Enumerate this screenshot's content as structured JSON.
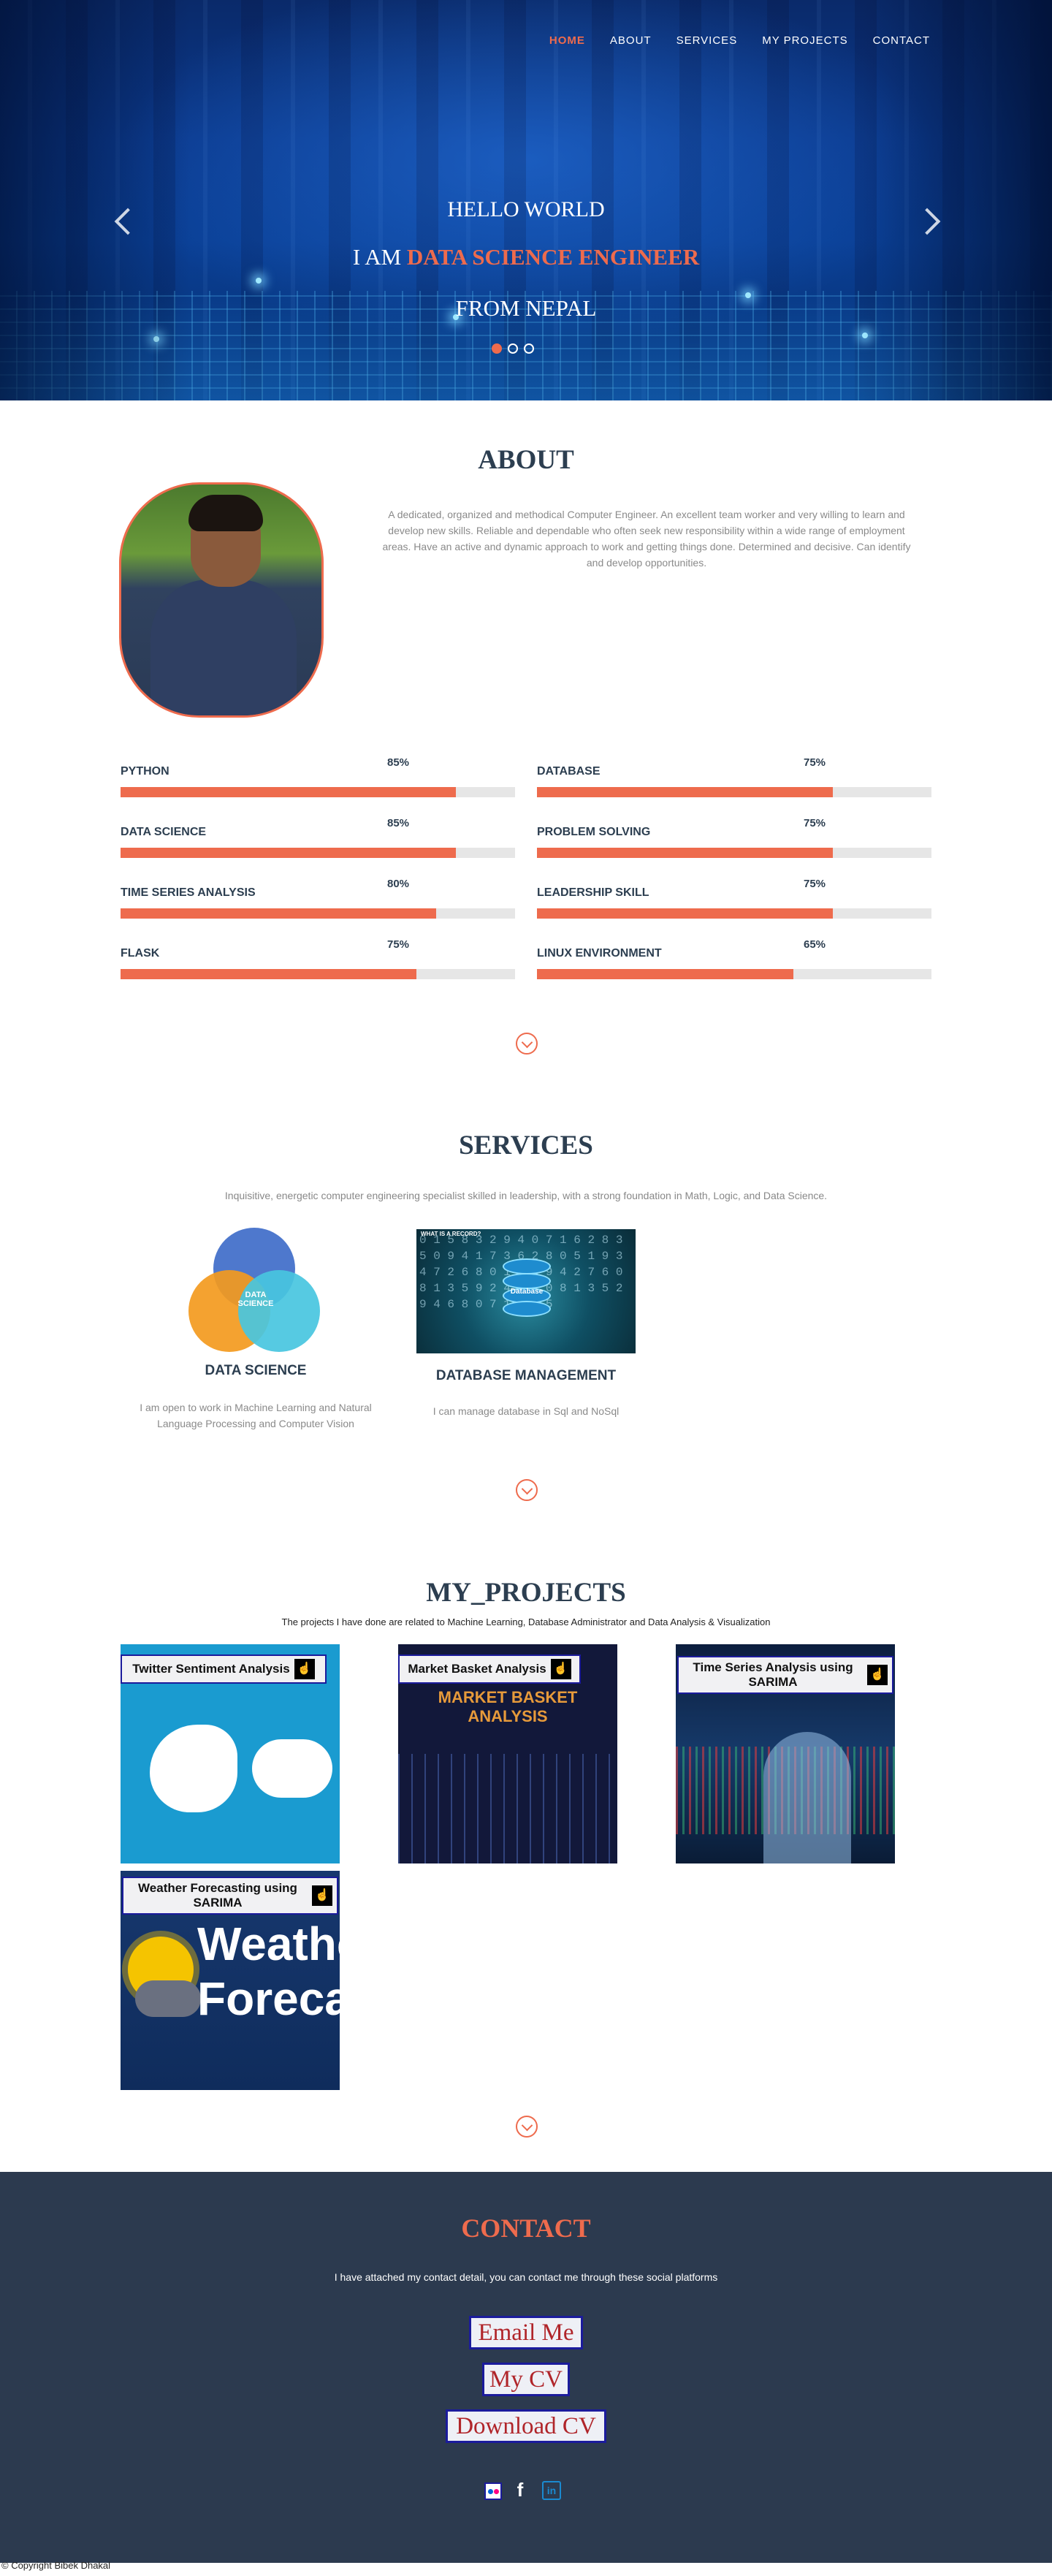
{
  "nav": {
    "items": [
      "HOME",
      "ABOUT",
      "SERVICES",
      "MY PROJECTS",
      "CONTACT"
    ]
  },
  "hero": {
    "line1": "HELLO WORLD",
    "line2_prefix": "I AM ",
    "line2_accent": "DATA SCIENCE ENGINEER",
    "line3": "FROM NEPAL",
    "active_slide": 1,
    "slide_count": 3
  },
  "about": {
    "title": "ABOUT",
    "text": "A dedicated, organized and methodical Computer Engineer. An excellent team worker and very willing to learn and develop new skills. Reliable and dependable who often seek new responsibility within a wide range of employment areas. Have an active and dynamic approach to work and getting things done. Determined and decisive. Can identify and develop opportunities.",
    "skills": [
      {
        "name": "PYTHON",
        "percent": "85%",
        "value": 85
      },
      {
        "name": "DATABASE",
        "percent": "75%",
        "value": 75
      },
      {
        "name": "DATA SCIENCE",
        "percent": "85%",
        "value": 85
      },
      {
        "name": "PROBLEM SOLVING",
        "percent": "75%",
        "value": 75
      },
      {
        "name": "TIME SERIES ANALYSIS",
        "percent": "80%",
        "value": 80
      },
      {
        "name": "LEADERSHIP SKILL",
        "percent": "75%",
        "value": 75
      },
      {
        "name": "FLASK",
        "percent": "75%",
        "value": 75
      },
      {
        "name": "LINUX ENVIRONMENT",
        "percent": "65%",
        "value": 65
      }
    ]
  },
  "services": {
    "title": "SERVICES",
    "subtitle": "Inquisitive, energetic computer engineering specialist skilled in leadership, with a strong foundation in Math, Logic, and Data Science.",
    "items": [
      {
        "title": "DATA SCIENCE",
        "desc": "I am open to work in Machine Learning and Natural Language Processing and Computer Vision"
      },
      {
        "title": "DATABASE MANAGEMENT",
        "desc": "I can manage database in Sql and NoSql"
      }
    ],
    "venn_center": "DATA SCIENCE",
    "db_label": "Database",
    "db_banner": "WHAT IS A RECORD?"
  },
  "projects": {
    "title": "MY_PROJECTS",
    "subtitle": "The projects I have done are related to Machine Learning, Database Administrator and Data Analysis & Visualization",
    "items": [
      {
        "label": "Twitter Sentiment Analysis"
      },
      {
        "label": "Market Basket Analysis",
        "banner": "MARKET BASKET ANALYSIS"
      },
      {
        "label": "Time Series Analysis using SARIMA"
      },
      {
        "label": "Weather Forecasting using SARIMA",
        "image_text_1": "Weather",
        "image_text_2": "Forecast"
      }
    ]
  },
  "contact": {
    "title": "CONTACT",
    "subtitle": "I have attached my contact detail, you can contact me through these social platforms",
    "buttons": [
      "Email Me",
      "My CV",
      "Download CV"
    ],
    "social_icons": [
      "flickr-icon",
      "facebook-icon",
      "linkedin-icon"
    ]
  },
  "footer": {
    "copyright": "© Copyright Bibek Dhakal"
  },
  "colors": {
    "accent": "#ee6b4d",
    "dark": "#2c3e50",
    "contact_bg": "#2c3a4f"
  }
}
